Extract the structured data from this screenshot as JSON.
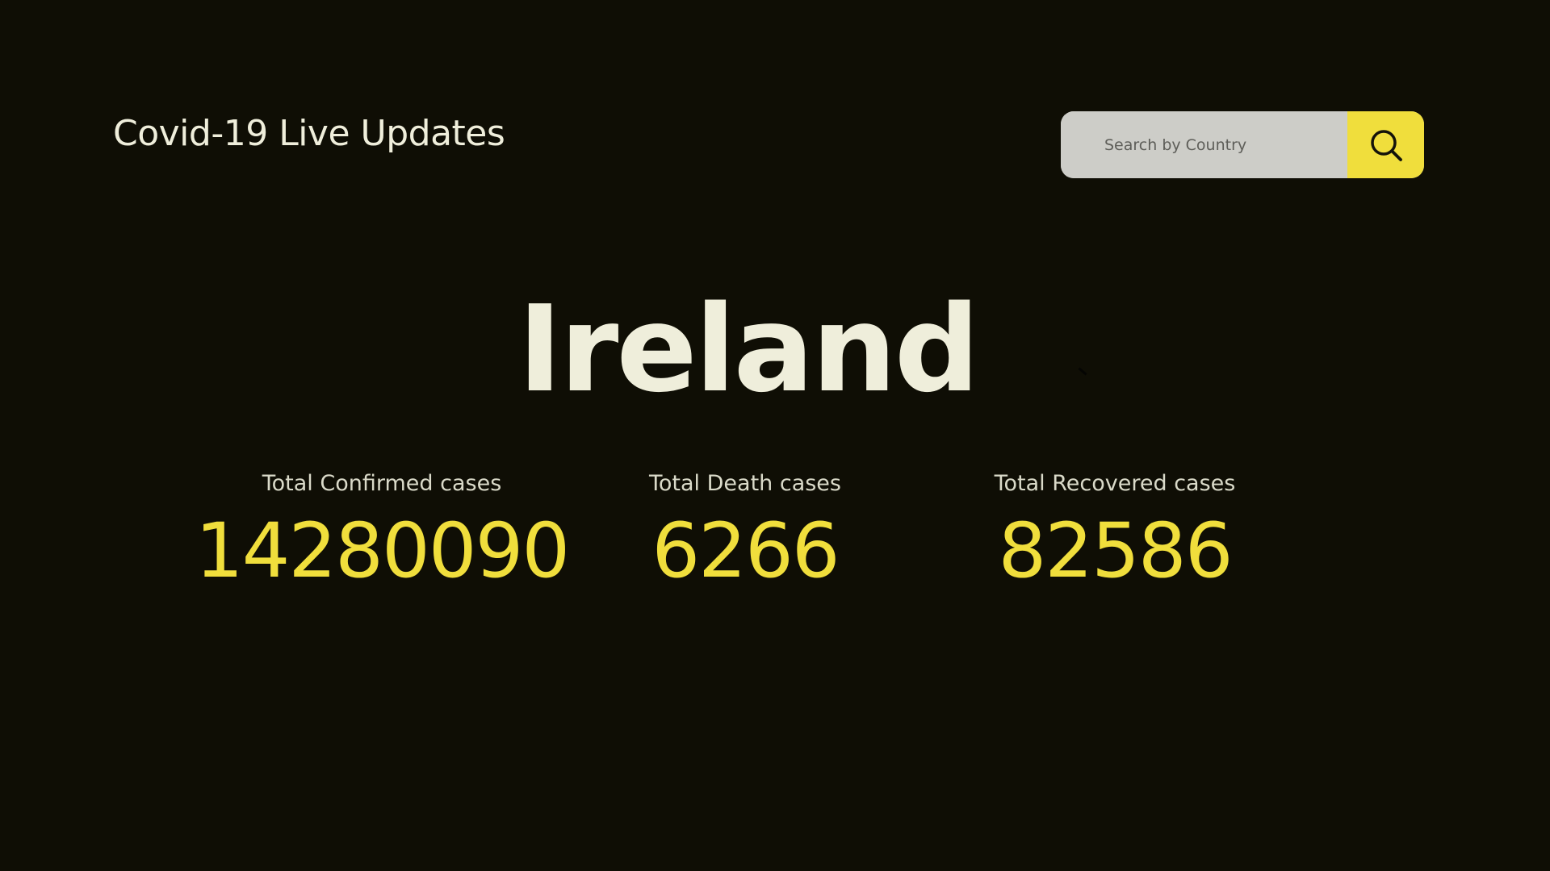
{
  "header": {
    "title": "Covid-19 Live Updates"
  },
  "search": {
    "placeholder": "Search by Country",
    "value": "",
    "button_icon": "search-icon"
  },
  "country": {
    "name": "Ireland"
  },
  "stats": {
    "confirmed": {
      "label": "Total Confirmed cases",
      "value": "14280090"
    },
    "deaths": {
      "label": "Total Death cases",
      "value": "6266"
    },
    "recovered": {
      "label": "Total Recovered cases",
      "value": "82586"
    }
  },
  "colors": {
    "background": "#0f0e05",
    "accent": "#f0de3c",
    "text_primary": "#efeedb",
    "search_field": "#cdcdc8"
  }
}
